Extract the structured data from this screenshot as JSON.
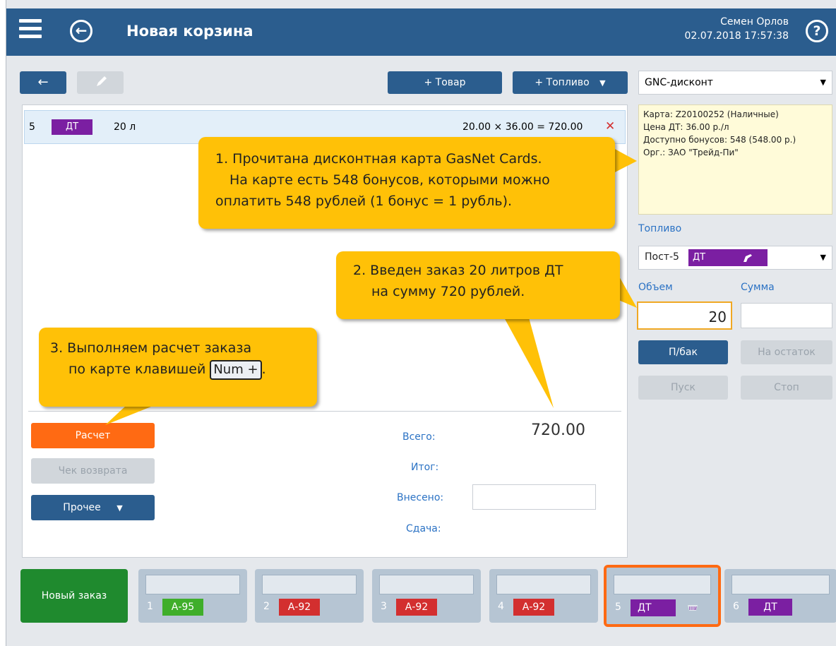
{
  "header": {
    "title": "Новая корзина",
    "user_name": "Семен Орлов",
    "datetime": "02.07.2018 17:57:38",
    "help_symbol": "?"
  },
  "toolbar": {
    "back_arrow": "←",
    "edit_icon": "edit-icon",
    "add_goods_label": "+ Товар",
    "add_fuel_label": "+ Топливо",
    "add_fuel_arrow": "▼"
  },
  "cart": {
    "items": [
      {
        "index": "5",
        "fuel": "ДТ",
        "volume": "20 л",
        "calc": "20.00 × 36.00 = 720.00",
        "remove": "✕"
      }
    ]
  },
  "discount": {
    "selected": "GNC-дисконт",
    "arrow": "▼",
    "card_info": [
      "Карта: Z20100252 (Наличные)",
      "Цена ДТ: 36.00 р./л",
      "Доступно бонусов: 548 (548.00 р.)",
      "Орг.: ЗАО \"Трейд-Пи\""
    ]
  },
  "fuel_panel": {
    "label": "Топливо",
    "pump_label": "Пост-5",
    "fuel_name": "ДТ",
    "arrow": "▼",
    "volume_label": "Объем",
    "volume_value": "20",
    "sum_label": "Сумма",
    "sum_value": "",
    "full_tank_label": "П/бак",
    "remainder_label": "На остаток",
    "start_label": "Пуск",
    "stop_label": "Стоп"
  },
  "actions": {
    "calc_label": "Расчет",
    "refund_label": "Чек возврата",
    "other_label": "Прочее",
    "other_arrow": "▼"
  },
  "totals": {
    "total_label": "Всего:",
    "total_value": "720.00",
    "result_label": "Итог:",
    "deposited_label": "Внесено:",
    "change_label": "Сдача:"
  },
  "tabs": {
    "new_order_label": "Новый заказ",
    "items": [
      {
        "num": "1",
        "fuel": "А-95",
        "color": "#3fae2a"
      },
      {
        "num": "2",
        "fuel": "А-92",
        "color": "#d32f2f"
      },
      {
        "num": "3",
        "fuel": "А-92",
        "color": "#d32f2f"
      },
      {
        "num": "4",
        "fuel": "А-92",
        "color": "#d32f2f"
      },
      {
        "num": "5",
        "fuel": "ДТ",
        "color": "#7b1fa2"
      },
      {
        "num": "6",
        "fuel": "ДТ",
        "color": "#7b1fa2"
      }
    ]
  },
  "callouts": {
    "c1": [
      "1. Прочитана дисконтная карта GasNet Cards.",
      "На карте есть 548 бонусов, которыми можно",
      "оплатить 548 рублей (1 бонус = 1 рубль)."
    ],
    "c2": [
      "2. Введен заказ 20 литров ДТ",
      "на сумму 720 рублей."
    ],
    "c3_line1": "3. Выполняем расчет заказа",
    "c3_line2_prefix": "по карте клавишей",
    "c3_key": "Num +",
    "c3_suffix": "."
  },
  "colors": {
    "primary": "#2b5d8e",
    "accent_orange": "#ff6a13",
    "callout": "#ffc107",
    "diesel": "#7b1fa2"
  }
}
